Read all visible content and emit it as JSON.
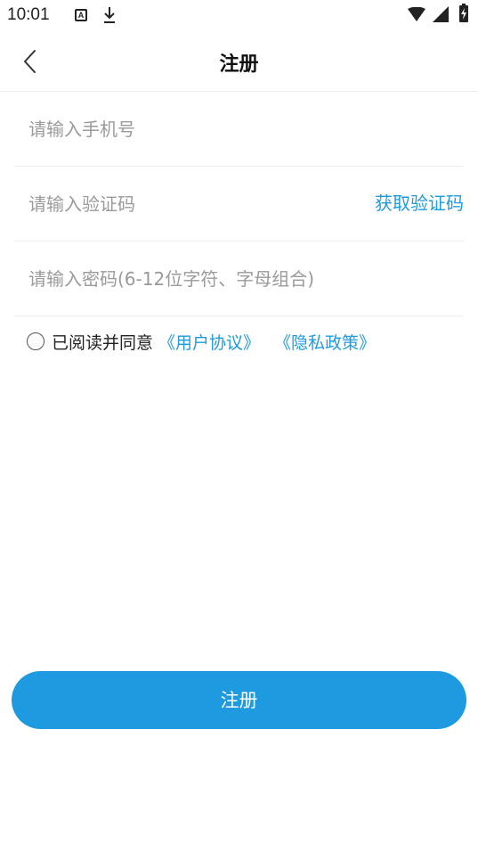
{
  "status_bar": {
    "time": "10:01",
    "icons": [
      "a-icon",
      "download-icon",
      "wifi-icon",
      "signal-icon",
      "battery-charging-icon"
    ]
  },
  "header": {
    "title": "注册",
    "back_icon": "chevron-left-icon"
  },
  "form": {
    "phone": {
      "value": "",
      "placeholder": "请输入手机号"
    },
    "code": {
      "value": "",
      "placeholder": "请输入验证码",
      "get_code_label": "获取验证码"
    },
    "password": {
      "value": "",
      "placeholder": "请输入密码(6-12位字符、字母组合)"
    }
  },
  "agreement": {
    "checked": false,
    "text": "已阅读并同意",
    "user_agreement_link": "《用户协议》",
    "privacy_policy_link": "《隐私政策》"
  },
  "register_button": {
    "label": "注册"
  },
  "colors": {
    "accent": "#1e9be0",
    "placeholder": "#9a9a9a",
    "divider": "#eeeeee"
  }
}
